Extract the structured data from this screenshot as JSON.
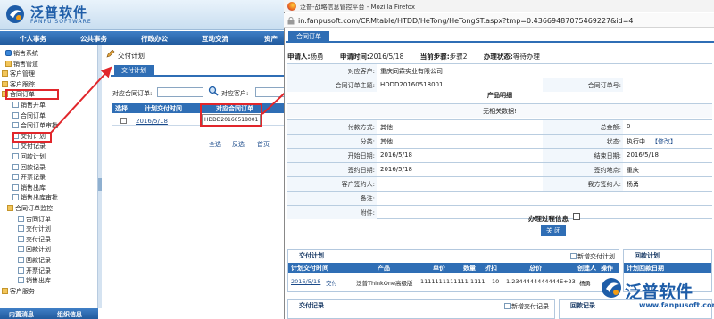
{
  "app": {
    "logo_cn": "泛普软件",
    "logo_en": "FANPU SOFTWARE",
    "nav": [
      "个人事务",
      "公共事务",
      "行政办公",
      "互动交流",
      "资产"
    ],
    "bottom_tabs": [
      "内置消息",
      "组织信息"
    ]
  },
  "sidebar": {
    "items": [
      {
        "label": "销售系统",
        "icon": "system-icon",
        "indent": 6
      },
      {
        "label": "销售管道",
        "icon": "folder-icon",
        "indent": 6
      },
      {
        "label": "客户管理",
        "icon": "folder-icon",
        "indent": 2
      },
      {
        "label": "客户跟踪",
        "icon": "folder-icon",
        "indent": 2
      },
      {
        "label": "合同订单",
        "icon": "folder-icon",
        "indent": 2
      },
      {
        "label": "销售开单",
        "icon": "page-icon",
        "indent": 14
      },
      {
        "label": "合同订单",
        "icon": "page-icon",
        "indent": 14
      },
      {
        "label": "合同订单审批",
        "icon": "page-icon",
        "indent": 14
      },
      {
        "label": "交付计划",
        "icon": "page-icon",
        "indent": 14
      },
      {
        "label": "交付记录",
        "icon": "page-icon",
        "indent": 14
      },
      {
        "label": "回款计划",
        "icon": "page-icon",
        "indent": 14
      },
      {
        "label": "回款记录",
        "icon": "page-icon",
        "indent": 14
      },
      {
        "label": "开票记录",
        "icon": "page-icon",
        "indent": 14
      },
      {
        "label": "销售出库",
        "icon": "page-icon",
        "indent": 14
      },
      {
        "label": "销售出库审批",
        "icon": "page-icon",
        "indent": 14
      },
      {
        "label": "合同订单监控",
        "icon": "folder-icon",
        "indent": 8
      },
      {
        "label": "合同订单",
        "icon": "page-icon",
        "indent": 20
      },
      {
        "label": "交付计划",
        "icon": "page-icon",
        "indent": 20
      },
      {
        "label": "交付记录",
        "icon": "page-icon",
        "indent": 20
      },
      {
        "label": "回款计划",
        "icon": "page-icon",
        "indent": 20
      },
      {
        "label": "回款记录",
        "icon": "page-icon",
        "indent": 20
      },
      {
        "label": "开票记录",
        "icon": "page-icon",
        "indent": 20
      },
      {
        "label": "销售出库",
        "icon": "page-icon",
        "indent": 20
      },
      {
        "label": "客户服务",
        "icon": "folder-icon",
        "indent": 2
      }
    ]
  },
  "content": {
    "breadcrumb": "交付计划",
    "subtab": "交付计划",
    "filter_contract_label": "对应合同订单:",
    "filter_customer_label": "对应客户:",
    "grid_headers": [
      "选择",
      "计划交付时间",
      "对应合同订单"
    ],
    "row": {
      "date": "2016/5/18",
      "code": "HDDD20160518001"
    },
    "footer": [
      "全选",
      "反选",
      "首页"
    ]
  },
  "firefox": {
    "title": "泛普-战略信息管控平台 - Mozilla Firefox",
    "url": "in.fanpusoft.com/CRMtable/HTDD/HeTong/HeTongST.aspx?tmp=0.43669487075469227&id=4",
    "page_tab": "合同订单"
  },
  "detail": {
    "applicant_label": "申请人:",
    "applicant": "杨勇",
    "apply_time_label": "申请时间:",
    "apply_time": "2016/5/18",
    "step_label": "当前步骤:",
    "step": "步骤2",
    "status_label": "办理状态:",
    "status": "等待办理",
    "customer_label": "对应客户:",
    "customer": "重庆同霖实业有限公司",
    "subject_label": "合同订单主题:",
    "subject": "HDDD20160518001",
    "number_label": "合同订单号:",
    "number": "",
    "products_title": "产品明细",
    "no_data": "无相关数据!",
    "pay_method_label": "付款方式:",
    "pay_method": "其他",
    "total_label": "总金额:",
    "total": "0",
    "category_label": "分类:",
    "category": "其他",
    "state_label": "状态:",
    "state": "执行中",
    "state_action": "【修改】",
    "start_label": "开始日期:",
    "start": "2016/5/18",
    "end_label": "结束日期:",
    "end": "2016/5/18",
    "sign_date_label": "签约日期:",
    "sign_date": "2016/5/18",
    "sign_place_label": "签约地点:",
    "sign_place": "重庆",
    "cust_signer_label": "客户签约人:",
    "cust_signer": "",
    "our_signer_label": "我方签约人:",
    "our_signer": "杨勇",
    "remark_label": "备注:",
    "attach_label": "附件:",
    "process_label": "办理过程信息",
    "close_button": "关 闭"
  },
  "panels": {
    "delivery_plan": {
      "title": "交付计划",
      "add": "新增交付计划",
      "headers": [
        "计划交付时间",
        "产品",
        "单价",
        "数量",
        "折扣",
        "总价",
        "创建人",
        "操作"
      ],
      "row": [
        "2016/5/18",
        "交付",
        "泛普ThinkOne高级版",
        "1111111111111",
        "1111",
        "10",
        "1.2344444444444E+23",
        "杨勇"
      ]
    },
    "payment_plan": {
      "title": "回款计划",
      "headers": [
        "计划回款日期"
      ]
    },
    "delivery_record": {
      "title": "交付记录",
      "add": "新增交付记录"
    },
    "payment_record": {
      "title": "回款记录"
    }
  },
  "watermark": {
    "cn": "泛普软件",
    "url": "www.fanpusoft.com"
  },
  "colors": {
    "brand_blue": "#2f6eb5",
    "highlight_red": "#e1262b"
  }
}
